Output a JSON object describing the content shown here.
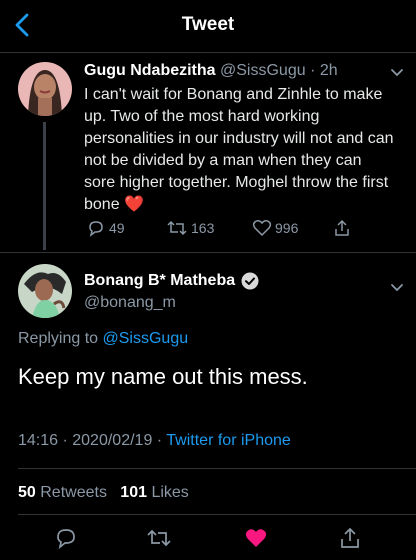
{
  "header": {
    "title": "Tweet"
  },
  "original_tweet": {
    "display_name": "Gugu Ndabezitha",
    "handle": "@SissGugu",
    "separator": " · ",
    "time": "2h",
    "text": "I can't wait for Bonang and Zinhle to make up. Two of the most hard working personalities in our industry will not and can not be divided by a man when they can sore higher together. Moghel throw the first bone",
    "emoji": "❤️",
    "replies": "49",
    "retweets": "163",
    "likes": "996"
  },
  "reply_tweet": {
    "display_name": "Bonang B* Matheba",
    "handle": "@bonang_m",
    "replying_prefix": "Replying to ",
    "replying_to": "@SissGugu",
    "text": "Keep my name out this mess.",
    "time": "14:16 · 2020/02/19",
    "meta_sep": " · ",
    "source": "Twitter for iPhone",
    "retweet_count": "50",
    "retweet_label": "Retweets",
    "like_count": "101",
    "like_label": "Likes"
  },
  "colors": {
    "accent": "#1d9bf0",
    "like": "#f91880",
    "muted": "#8b98a5"
  },
  "icons": [
    "back-arrow-icon",
    "chevron-down-icon",
    "reply-icon",
    "retweet-icon",
    "heart-icon",
    "share-icon",
    "verified-badge-icon"
  ]
}
